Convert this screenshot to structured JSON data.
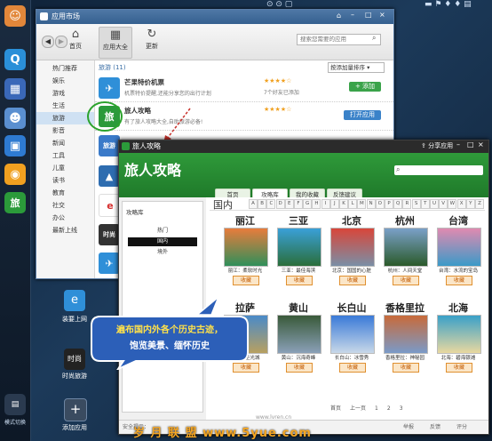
{
  "market": {
    "title": "应用市场",
    "toolbar": [
      {
        "label": "首页",
        "icon": "home-icon"
      },
      {
        "label": "应用大全",
        "icon": "grid-icon"
      },
      {
        "label": "更新",
        "icon": "refresh-icon"
      }
    ],
    "search_placeholder": "搜索您需要的应用",
    "categories": [
      "热门推荐",
      "娱乐",
      "游戏",
      "生活",
      "旅游",
      "影音",
      "新闻",
      "工具",
      "儿童",
      "读书",
      "教育",
      "社交",
      "办公",
      "最新上线"
    ],
    "selected_category": "旅游",
    "section_label": "旅游 (11)",
    "sort_label": "按添加量排序",
    "apps": [
      {
        "name": "芒果特价机票",
        "desc": "机票特价提醒,还能分享您的出行计划",
        "stats": "7个好友已添加",
        "button": "添加"
      },
      {
        "name": "旅人攻略",
        "desc": "有了旅人攻略大全,自助旅游必备!",
        "button": "打开应用"
      }
    ]
  },
  "desktop": {
    "icon_labels": [
      "装要上网",
      "时尚旅游",
      "添加应用"
    ],
    "mode_label": "模式切换"
  },
  "travel": {
    "window_title": "旅人攻略",
    "share_label": "分享应用",
    "header_title": "旅人攻略",
    "tabs": [
      "首页",
      "攻略库",
      "我的收藏",
      "反馈建议"
    ],
    "sidebar_title": "攻略库",
    "sidebar_items": [
      "热门",
      "国内",
      "境外"
    ],
    "section_title": "国内",
    "letters": [
      "A",
      "B",
      "C",
      "D",
      "E",
      "F",
      "G",
      "H",
      "I",
      "J",
      "K",
      "L",
      "M",
      "N",
      "O",
      "P",
      "Q",
      "R",
      "S",
      "T",
      "U",
      "V",
      "W",
      "X",
      "Y",
      "Z"
    ],
    "cards": [
      {
        "title": "丽江",
        "caption": "丽江：柔软时光",
        "button": "收藏"
      },
      {
        "title": "三亚",
        "caption": "三亚：最佳海滨",
        "button": "收藏"
      },
      {
        "title": "北京",
        "caption": "北京：国国的心脏",
        "button": "收藏"
      },
      {
        "title": "杭州",
        "caption": "杭州：人间天堂",
        "button": "收藏"
      },
      {
        "title": "台湾",
        "caption": "台湾：水流的宝岛",
        "button": "收藏"
      },
      {
        "title": "拉萨",
        "caption": "拉萨：圣光城",
        "button": "收藏"
      },
      {
        "title": "黄山",
        "caption": "黄山：沉海奇峰",
        "button": "收藏"
      },
      {
        "title": "长白山",
        "caption": "长白山：冰雪秀",
        "button": "收藏"
      },
      {
        "title": "香格里拉",
        "caption": "香格里拉：神秘园",
        "button": "收藏"
      },
      {
        "title": "北海",
        "caption": "北海：碧海银滩",
        "button": "收藏"
      }
    ],
    "pagination": [
      "首页",
      "上一页",
      "1",
      "2",
      "3"
    ],
    "footer_url": "www.lvren.cn",
    "status_left": "安全提示：",
    "status_right": [
      "举报",
      "反馈",
      "评分"
    ]
  },
  "callout_text": [
    "遍布国内外各个历史古迹，",
    "饱览美景、缅怀历史"
  ],
  "watermark": "岁 月 联 盟   www.5yue.com"
}
